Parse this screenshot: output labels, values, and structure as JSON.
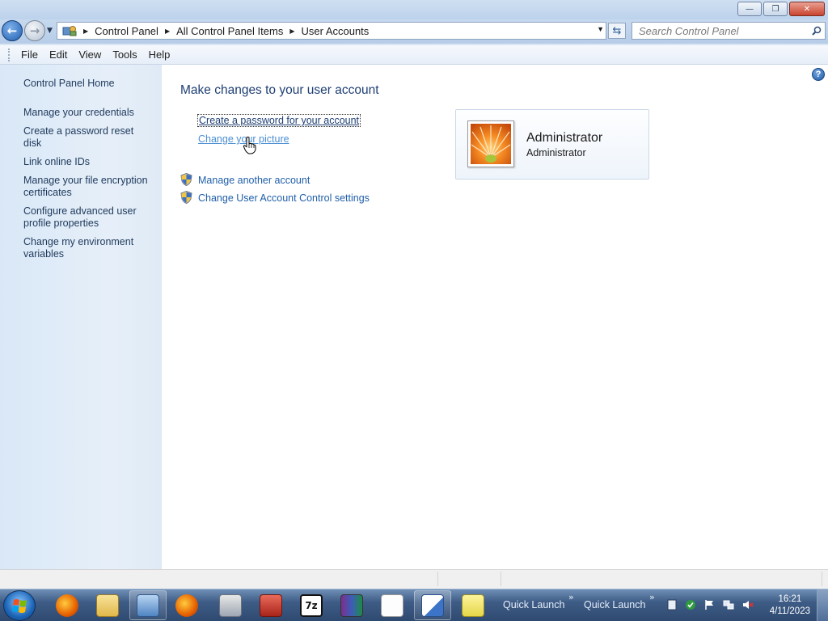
{
  "window": {
    "buttons": {
      "minimize": "—",
      "maximize": "❐",
      "close": "✕"
    }
  },
  "address": {
    "breadcrumbs": [
      "Control Panel",
      "All Control Panel Items",
      "User Accounts"
    ],
    "search_placeholder": "Search Control Panel"
  },
  "menu": [
    "File",
    "Edit",
    "View",
    "Tools",
    "Help"
  ],
  "sidebar": {
    "home": "Control Panel Home",
    "links": [
      "Manage your credentials",
      "Create a password reset disk",
      "Link online IDs",
      "Manage your file encryption certificates",
      "Configure advanced user profile properties",
      "Change my environment variables"
    ]
  },
  "main": {
    "title": "Make changes to your user account",
    "tasks": {
      "create_password": "Create a password for your account",
      "change_picture": "Change your picture",
      "manage_another": "Manage another account",
      "uac_settings": "Change User Account Control settings"
    },
    "account": {
      "name": "Administrator",
      "type": "Administrator"
    }
  },
  "taskbar": {
    "quick_launch": [
      "Quick Launch",
      "Quick Launch"
    ],
    "clock": {
      "time": "16:21",
      "date": "4/11/2023"
    }
  },
  "colors": {
    "link": "#1f5fa9",
    "title": "#1e3f74",
    "sidebar_bg": "#dfeaf6",
    "taskbar": "#3e5c86"
  }
}
